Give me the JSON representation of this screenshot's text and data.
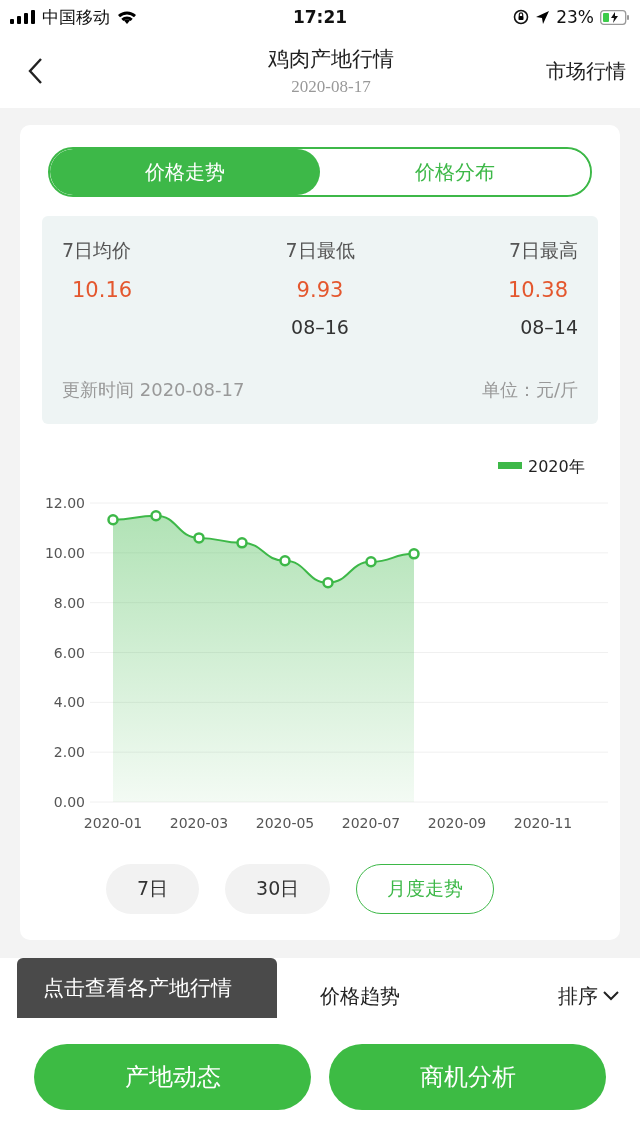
{
  "status_bar": {
    "carrier": "中国移动",
    "time": "17:21",
    "battery": "23%"
  },
  "header": {
    "title": "鸡肉产地行情",
    "date": "2020-08-17",
    "action": "市场行情"
  },
  "tabs": [
    {
      "label": "价格走势",
      "selected": true
    },
    {
      "label": "价格分布",
      "selected": false
    }
  ],
  "stats": {
    "items": [
      {
        "label": "7日均价",
        "value": "10.16"
      },
      {
        "label": "7日最低",
        "value": "9.93",
        "date": "08–16"
      },
      {
        "label": "7日最高",
        "value": "10.38",
        "date": "08–14"
      }
    ],
    "updated": "更新时间 2020-08-17",
    "unit": "单位：元/斤"
  },
  "chart_data": {
    "type": "area",
    "categories": [
      "2020-01",
      null,
      "2020-03",
      null,
      "2020-05",
      null,
      "2020-07",
      null,
      "2020-09",
      null,
      "2020-11",
      null
    ],
    "ylim": [
      0,
      12
    ],
    "grid": true,
    "yticks": [
      {
        "value": 0,
        "label": "0.00"
      },
      {
        "value": 2,
        "label": "2.00"
      },
      {
        "value": 4,
        "label": "4.00"
      },
      {
        "value": 6,
        "label": "6.00"
      },
      {
        "value": 8,
        "label": "8.00"
      },
      {
        "value": 10,
        "label": "10.00"
      },
      {
        "value": 12,
        "label": "12.00"
      }
    ],
    "series": [
      {
        "name": "2020年",
        "color": "#3db848",
        "values": [
          11.33,
          11.49,
          10.6,
          10.4,
          9.68,
          8.8,
          9.64,
          9.96,
          null,
          null,
          null,
          null
        ]
      }
    ]
  },
  "periods": [
    {
      "label": "7日",
      "selected": false
    },
    {
      "label": "30日",
      "selected": false
    },
    {
      "label": "月度走势",
      "selected": true
    }
  ],
  "list_header": {
    "columns": [
      "价格趋势",
      "排序"
    ]
  },
  "tooltip": "点击查看各产地行情",
  "buttons": [
    "产地动态",
    "商机分析"
  ]
}
